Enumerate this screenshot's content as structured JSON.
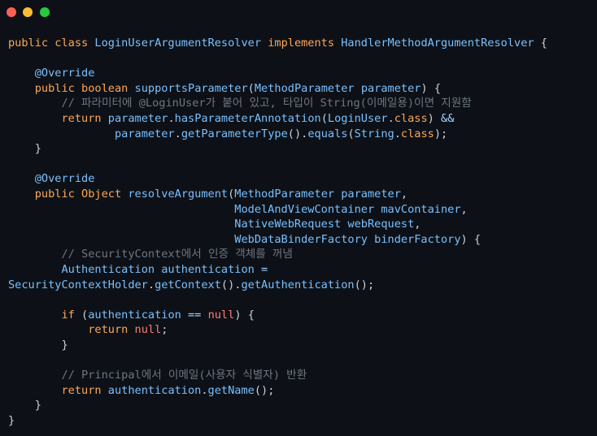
{
  "window": {
    "controls": {
      "close_color": "#ff5f56",
      "minimize_color": "#ffbd2e",
      "maximize_color": "#27c93f"
    }
  },
  "editor": {
    "background": "#0d1117",
    "language": "java",
    "lines": [
      "public class LoginUserArgumentResolver implements HandlerMethodArgumentResolver {",
      "",
      "    @Override",
      "    public boolean supportsParameter(MethodParameter parameter) {",
      "        // 파라미터에 @LoginUser가 붙어 있고, 타입이 String(이메일용)이면 지원함",
      "        return parameter.hasParameterAnnotation(LoginUser.class) &&",
      "                parameter.getParameterType().equals(String.class);",
      "    }",
      "",
      "    @Override",
      "    public Object resolveArgument(MethodParameter parameter,",
      "                                  ModelAndViewContainer mavContainer,",
      "                                  NativeWebRequest webRequest,",
      "                                  WebDataBinderFactory binderFactory) {",
      "        // SecurityContext에서 인증 객체를 꺼냄",
      "        Authentication authentication =",
      "SecurityContextHolder.getContext().getAuthentication();",
      "",
      "        if (authentication == null) {",
      "            return null;",
      "        }",
      "",
      "        // Principal에서 이메일(사용자 식별자) 반환",
      "        return authentication.getName();",
      "    }",
      "}"
    ]
  }
}
